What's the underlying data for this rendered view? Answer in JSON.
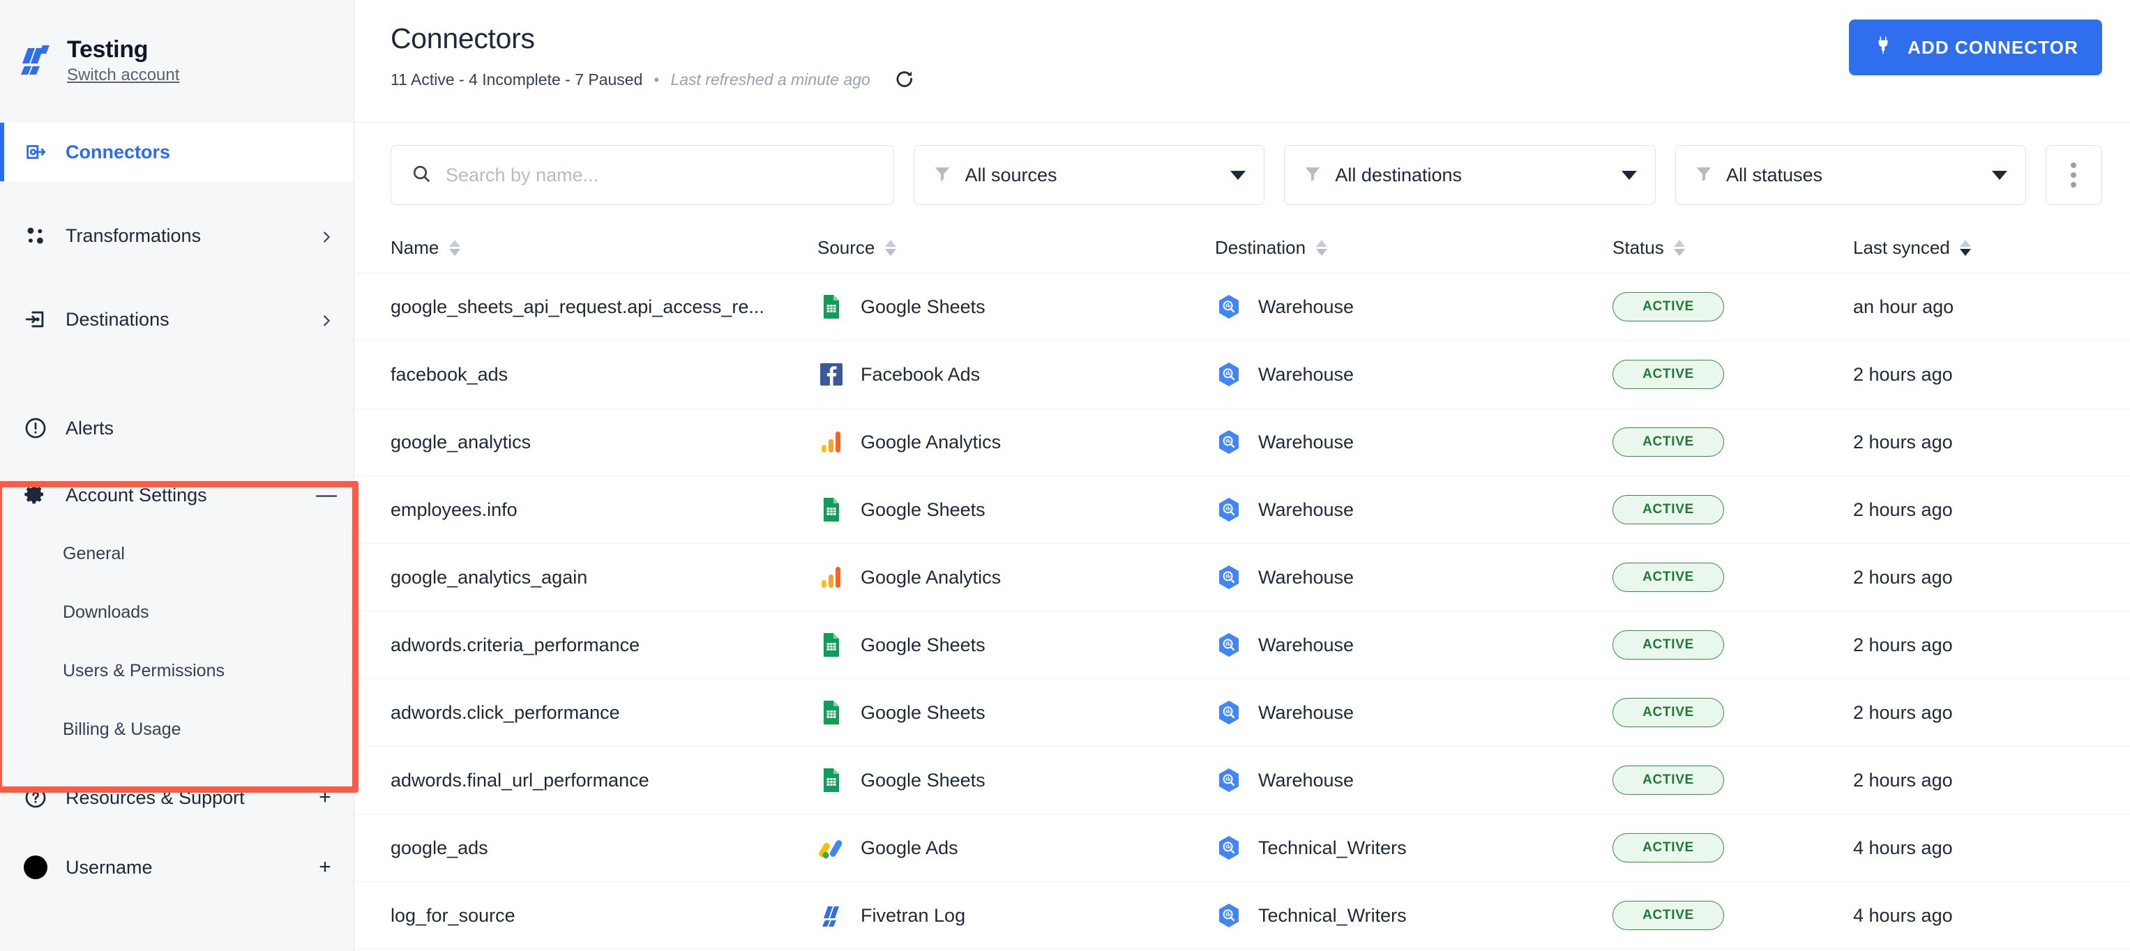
{
  "sidebar": {
    "brand": {
      "name": "Testing",
      "switch_label": "Switch account",
      "logo_icon": "fivetran-logo-icon"
    },
    "nav": [
      {
        "label": "Connectors",
        "icon": "connectors-icon",
        "active": true,
        "affordance": "none"
      },
      {
        "label": "Transformations",
        "icon": "transformations-icon",
        "active": false,
        "affordance": "chevron-right"
      },
      {
        "label": "Destinations",
        "icon": "destinations-icon",
        "active": false,
        "affordance": "chevron-right"
      },
      {
        "label": "Alerts",
        "icon": "alert-circle-icon",
        "active": false,
        "affordance": "none"
      },
      {
        "label": "Account Settings",
        "icon": "gear-icon",
        "active": false,
        "affordance": "minus"
      },
      {
        "label": "Resources & Support",
        "icon": "question-circle-icon",
        "active": false,
        "affordance": "plus"
      },
      {
        "label": "Username",
        "icon": "avatar",
        "active": false,
        "affordance": "plus"
      }
    ],
    "account_settings_children": [
      {
        "label": "General"
      },
      {
        "label": "Downloads"
      },
      {
        "label": "Users & Permissions"
      },
      {
        "label": "Billing & Usage"
      }
    ]
  },
  "header": {
    "title": "Connectors",
    "stats": "11 Active - 4 Incomplete - 7 Paused",
    "separator": "•",
    "last_refreshed": "Last refreshed a minute ago",
    "refresh_icon": "refresh-icon",
    "add_button_label": "ADD CONNECTOR",
    "add_button_icon": "plug-icon",
    "accent_color": "#2f6fed"
  },
  "filters": {
    "search_placeholder": "Search by name...",
    "search_value": "",
    "search_icon": "search-icon",
    "sources_label": "All sources",
    "destinations_label": "All destinations",
    "statuses_label": "All statuses",
    "filter_icon": "funnel-icon",
    "overflow_icon": "kebab-menu-icon"
  },
  "table": {
    "columns": [
      {
        "key": "name",
        "label": "Name",
        "sort": "none"
      },
      {
        "key": "source",
        "label": "Source",
        "sort": "none"
      },
      {
        "key": "destination",
        "label": "Destination",
        "sort": "none"
      },
      {
        "key": "status",
        "label": "Status",
        "sort": "none"
      },
      {
        "key": "last_synced",
        "label": "Last synced",
        "sort": "desc"
      }
    ],
    "rows": [
      {
        "name": "google_sheets_api_request.api_access_re...",
        "source": "Google Sheets",
        "source_icon": "google-sheets-icon",
        "destination": "Warehouse",
        "destination_icon": "bigquery-icon",
        "status": "ACTIVE",
        "last_synced": "an hour ago"
      },
      {
        "name": "facebook_ads",
        "source": "Facebook Ads",
        "source_icon": "facebook-ads-icon",
        "destination": "Warehouse",
        "destination_icon": "bigquery-icon",
        "status": "ACTIVE",
        "last_synced": "2 hours ago"
      },
      {
        "name": "google_analytics",
        "source": "Google Analytics",
        "source_icon": "google-analytics-icon",
        "destination": "Warehouse",
        "destination_icon": "bigquery-icon",
        "status": "ACTIVE",
        "last_synced": "2 hours ago"
      },
      {
        "name": "employees.info",
        "source": "Google Sheets",
        "source_icon": "google-sheets-icon",
        "destination": "Warehouse",
        "destination_icon": "bigquery-icon",
        "status": "ACTIVE",
        "last_synced": "2 hours ago"
      },
      {
        "name": "google_analytics_again",
        "source": "Google Analytics",
        "source_icon": "google-analytics-icon",
        "destination": "Warehouse",
        "destination_icon": "bigquery-icon",
        "status": "ACTIVE",
        "last_synced": "2 hours ago"
      },
      {
        "name": "adwords.criteria_performance",
        "source": "Google Sheets",
        "source_icon": "google-sheets-icon",
        "destination": "Warehouse",
        "destination_icon": "bigquery-icon",
        "status": "ACTIVE",
        "last_synced": "2 hours ago"
      },
      {
        "name": "adwords.click_performance",
        "source": "Google Sheets",
        "source_icon": "google-sheets-icon",
        "destination": "Warehouse",
        "destination_icon": "bigquery-icon",
        "status": "ACTIVE",
        "last_synced": "2 hours ago"
      },
      {
        "name": "adwords.final_url_performance",
        "source": "Google Sheets",
        "source_icon": "google-sheets-icon",
        "destination": "Warehouse",
        "destination_icon": "bigquery-icon",
        "status": "ACTIVE",
        "last_synced": "2 hours ago"
      },
      {
        "name": "google_ads",
        "source": "Google Ads",
        "source_icon": "google-ads-icon",
        "destination": "Technical_Writers",
        "destination_icon": "bigquery-icon",
        "status": "ACTIVE",
        "last_synced": "4 hours ago"
      },
      {
        "name": "log_for_source",
        "source": "Fivetran Log",
        "source_icon": "fivetran-log-icon",
        "destination": "Technical_Writers",
        "destination_icon": "bigquery-icon",
        "status": "ACTIVE",
        "last_synced": "4 hours ago"
      }
    ]
  },
  "annotation": {
    "color": "#ff5a46",
    "highlights": "account-settings-section"
  }
}
